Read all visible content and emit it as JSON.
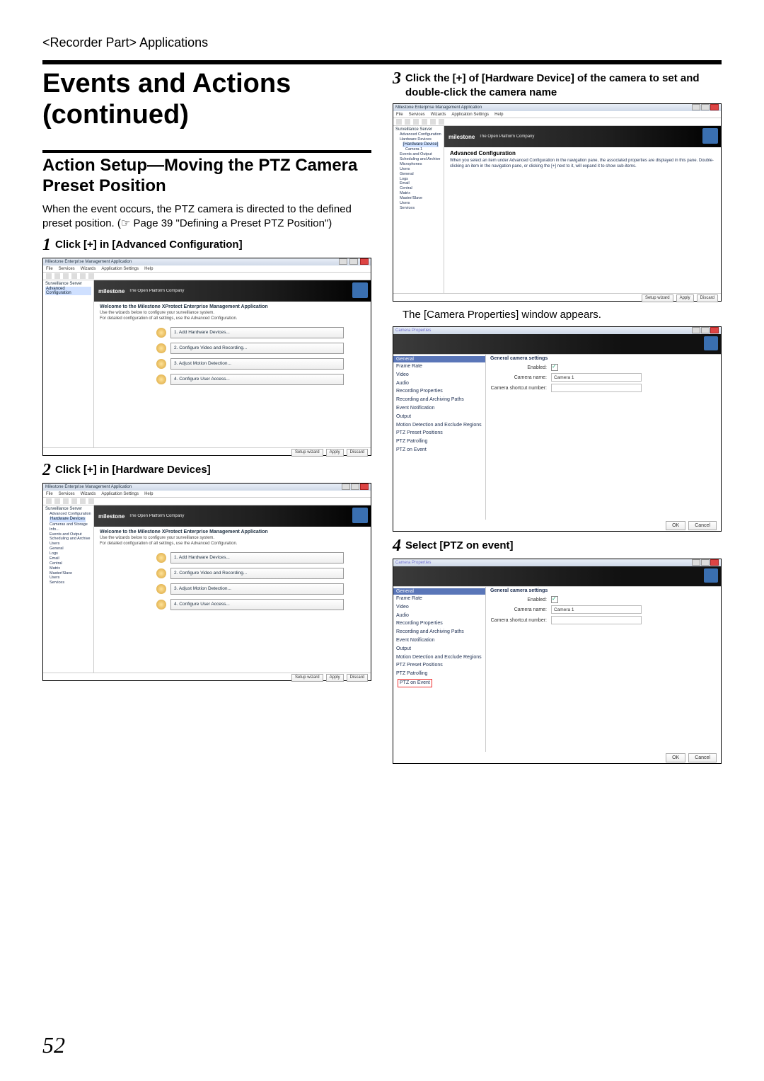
{
  "breadcrumb": "<Recorder Part> Applications",
  "page_number": "52",
  "main_title": "Events and Actions (continued)",
  "section_title": "Action Setup—Moving the PTZ Camera Preset Position",
  "intro_text": "When the event occurs, the PTZ camera is directed to the defined preset position. (☞ Page 39 \"Defining a Preset PTZ Position\")",
  "steps": {
    "s1": {
      "num": "1",
      "text": "Click [+] in [Advanced Configuration]"
    },
    "s2": {
      "num": "2",
      "text": "Click [+] in [Hardware Devices]"
    },
    "s3": {
      "num": "3",
      "text": "Click the [+] of [Hardware Device] of the camera to set and double-click the camera name"
    },
    "s4": {
      "num": "4",
      "text": "Select [PTZ on event]"
    }
  },
  "caption_after_s3": "The [Camera Properties] window appears.",
  "wizard_fig": {
    "window_title": "Milestone Enterprise Management Application",
    "menu": [
      "File",
      "Services",
      "Wizards",
      "Application Settings",
      "Help"
    ],
    "brand": "milestone",
    "brand_tag": "The Open Platform Company",
    "welcome_title": "Welcome to the Milestone XProtect Enterprise Management Application",
    "welcome_desc_l1": "Use the wizards below to configure your surveillance system.",
    "welcome_desc_l2": "For detailed configuration of all settings, use the Advanced Configuration.",
    "buttons": {
      "b1": "1. Add Hardware Devices...",
      "b2": "2. Configure Video and Recording...",
      "b3": "3. Adjust Motion Detection...",
      "b4": "4. Configure User Access..."
    },
    "status": {
      "left": "Setup wizard",
      "mid": "Apply",
      "right": "Discard"
    }
  },
  "wizard_tree_s1": {
    "root": "Surveillance Server",
    "selected": "Advanced Configuration"
  },
  "wizard_tree_s2": {
    "root": "Surveillance Server",
    "adv": "Advanced Configuration",
    "selected": "Hardware Devices",
    "children": [
      "Cameras and Storage Info...",
      "Events and Output",
      "Scheduling and Archive",
      "Users",
      "General",
      "Logs",
      "Email",
      "Central",
      "Matrix",
      "Master/Slave",
      "Users",
      "Services"
    ]
  },
  "adv_fig": {
    "window_title": "Milestone Enterprise Management Application",
    "tree_root": "Surveillance Server",
    "tree_adv": "Advanced Configuration",
    "tree_hd": "Hardware Devices",
    "tree_dev": "[Hardware Device]",
    "tree_cam": "Camera 1",
    "tree_after": [
      "Events and Output",
      "Scheduling and Archive",
      "Microphones",
      "Users",
      "General",
      "Logs",
      "Email",
      "Central",
      "Matrix",
      "Master/Slave",
      "Users",
      "Services"
    ],
    "pane_title": "Advanced Configuration",
    "pane_desc": "When you select an item under Advanced Configuration in the navigation pane, the associated properties are displayed in this pane. Double-clicking an item in the navigation pane, or clicking the [+] next to it, will expand it to show sub-items."
  },
  "props_fig": {
    "window_title": "Camera Properties",
    "nav_head": "General",
    "nav_items": [
      "Frame Rate",
      "Video",
      "Audio",
      "Recording Properties",
      "Recording and Archiving Paths",
      "Event Notification",
      "Output",
      "Motion Detection and Exclude Regions",
      "PTZ Preset Positions",
      "PTZ Patrolling",
      "PTZ on Event"
    ],
    "section": "General camera settings",
    "row_enabled": "Enabled:",
    "row_camname": "Camera name:",
    "row_camname_val": "Camera 1",
    "row_shortcut": "Camera shortcut number:",
    "ok": "OK",
    "cancel": "Cancel"
  }
}
